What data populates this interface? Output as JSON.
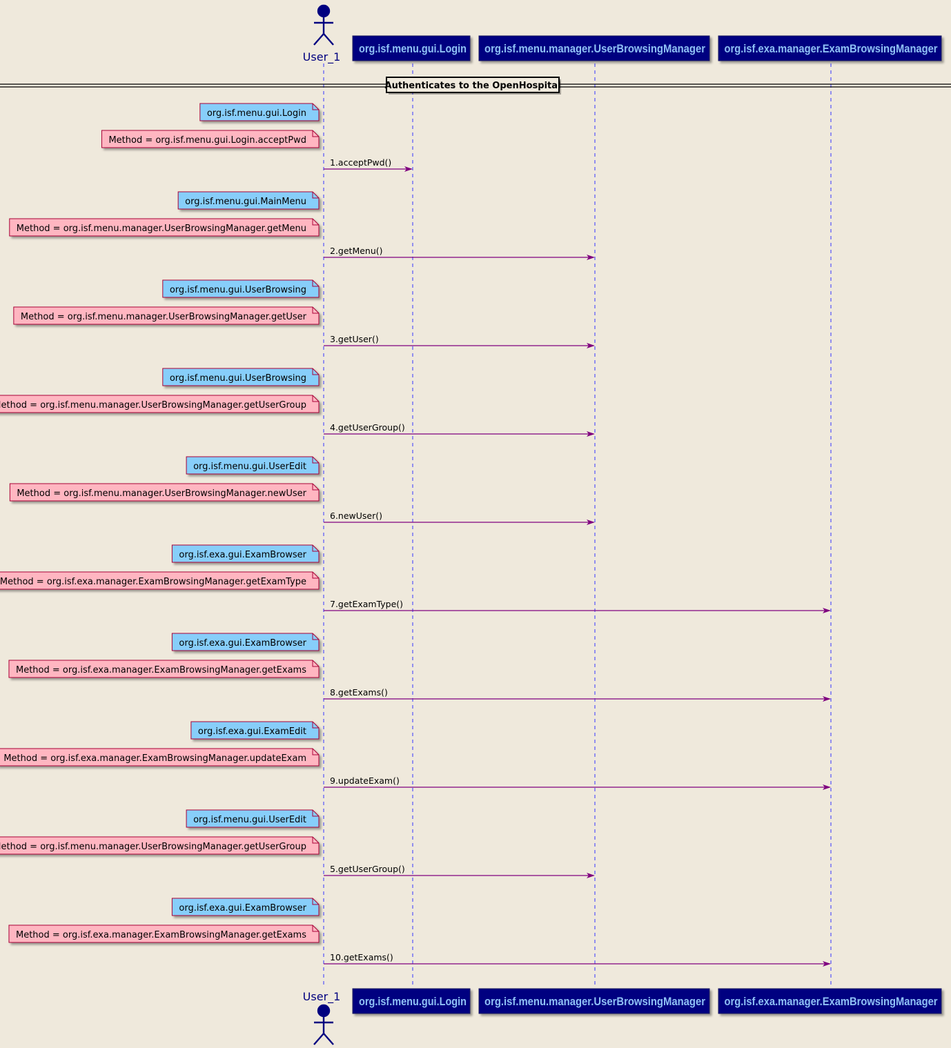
{
  "actor": {
    "name": "User_1"
  },
  "participants": [
    "org.isf.menu.gui.Login",
    "org.isf.menu.manager.UserBrowsingManager",
    "org.isf.exa.manager.ExamBrowsingManager"
  ],
  "divider": "Authenticates to the OpenHospital",
  "steps": [
    {
      "gui": "org.isf.menu.gui.Login",
      "method": "Method = org.isf.menu.gui.Login.acceptPwd",
      "message": "1.acceptPwd()",
      "target": 0
    },
    {
      "gui": "org.isf.menu.gui.MainMenu",
      "method": "Method = org.isf.menu.manager.UserBrowsingManager.getMenu",
      "message": "2.getMenu()",
      "target": 1
    },
    {
      "gui": "org.isf.menu.gui.UserBrowsing",
      "method": "Method = org.isf.menu.manager.UserBrowsingManager.getUser",
      "message": "3.getUser()",
      "target": 1
    },
    {
      "gui": "org.isf.menu.gui.UserBrowsing",
      "method": "Method = org.isf.menu.manager.UserBrowsingManager.getUserGroup",
      "message": "4.getUserGroup()",
      "target": 1
    },
    {
      "gui": "org.isf.menu.gui.UserEdit",
      "method": "Method = org.isf.menu.manager.UserBrowsingManager.newUser",
      "message": "6.newUser()",
      "target": 1
    },
    {
      "gui": "org.isf.exa.gui.ExamBrowser",
      "method": "Method = org.isf.exa.manager.ExamBrowsingManager.getExamType",
      "message": "7.getExamType()",
      "target": 2
    },
    {
      "gui": "org.isf.exa.gui.ExamBrowser",
      "method": "Method = org.isf.exa.manager.ExamBrowsingManager.getExams",
      "message": "8.getExams()",
      "target": 2
    },
    {
      "gui": "org.isf.exa.gui.ExamEdit",
      "method": "Method = org.isf.exa.manager.ExamBrowsingManager.updateExam",
      "message": "9.updateExam()",
      "target": 2
    },
    {
      "gui": "org.isf.menu.gui.UserEdit",
      "method": "Method = org.isf.menu.manager.UserBrowsingManager.getUserGroup",
      "message": "5.getUserGroup()",
      "target": 1
    },
    {
      "gui": "org.isf.exa.gui.ExamBrowser",
      "method": "Method = org.isf.exa.manager.ExamBrowsingManager.getExams",
      "message": "10.getExams()",
      "target": 2
    }
  ],
  "colors": {
    "background": "#EFE9DC",
    "participant_fill": "#000080",
    "participant_text": "#8FC1F5",
    "lifeline": "#3333FF",
    "arrow": "#7F007F",
    "gui_note": "#87CEFA",
    "method_note": "#FFB6C1",
    "note_border": "#A80036",
    "actor": "#000080"
  }
}
